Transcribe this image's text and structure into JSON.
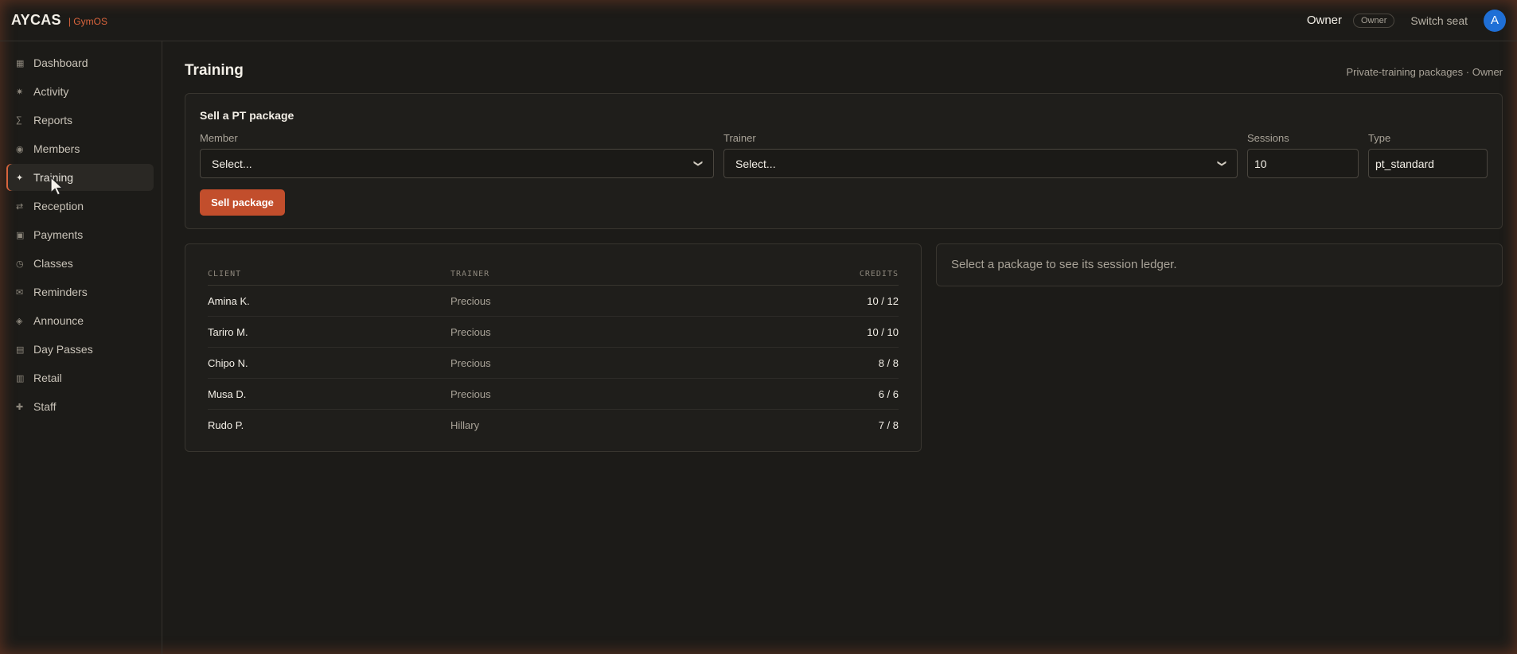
{
  "brand": {
    "name": "AYCAS",
    "product": "| GymOS"
  },
  "topbar": {
    "user": "Owner",
    "role": "Owner",
    "switch_seat": "Switch seat",
    "avatar_letter": "A"
  },
  "sidebar": {
    "items": [
      {
        "label": "Dashboard",
        "icon": "grid-icon"
      },
      {
        "label": "Activity",
        "icon": "sparkle-icon"
      },
      {
        "label": "Reports",
        "icon": "sigma-icon"
      },
      {
        "label": "Members",
        "icon": "members-icon"
      },
      {
        "label": "Training",
        "icon": "star-icon",
        "active": true
      },
      {
        "label": "Reception",
        "icon": "swap-icon"
      },
      {
        "label": "Payments",
        "icon": "card-icon"
      },
      {
        "label": "Classes",
        "icon": "clock-icon"
      },
      {
        "label": "Reminders",
        "icon": "mail-icon"
      },
      {
        "label": "Announce",
        "icon": "diamond-icon"
      },
      {
        "label": "Day Passes",
        "icon": "ticket-icon"
      },
      {
        "label": "Retail",
        "icon": "store-icon"
      },
      {
        "label": "Staff",
        "icon": "plus-icon"
      }
    ]
  },
  "page": {
    "title": "Training",
    "subtitle": "Private-training packages · Owner"
  },
  "sell": {
    "title": "Sell a PT package",
    "member_label": "Member",
    "member_value": "Select...",
    "trainer_label": "Trainer",
    "trainer_value": "Select...",
    "sessions_label": "Sessions",
    "sessions_value": "10",
    "type_label": "Type",
    "type_value": "pt_standard",
    "button": "Sell package"
  },
  "packages": {
    "headers": {
      "client": "CLIENT",
      "trainer": "TRAINER",
      "credits": "CREDITS"
    },
    "rows": [
      {
        "client": "Amina K.",
        "trainer": "Precious",
        "credits": "10 / 12"
      },
      {
        "client": "Tariro M.",
        "trainer": "Precious",
        "credits": "10 / 10"
      },
      {
        "client": "Chipo N.",
        "trainer": "Precious",
        "credits": "8 / 8"
      },
      {
        "client": "Musa D.",
        "trainer": "Precious",
        "credits": "6 / 6"
      },
      {
        "client": "Rudo P.",
        "trainer": "Hillary",
        "credits": "7 / 8"
      }
    ]
  },
  "ledger": {
    "empty_text": "Select a package to see its session ledger."
  },
  "colors": {
    "accent": "#d9643c",
    "button": "#c24e2c",
    "avatar": "#1f6fd6"
  }
}
